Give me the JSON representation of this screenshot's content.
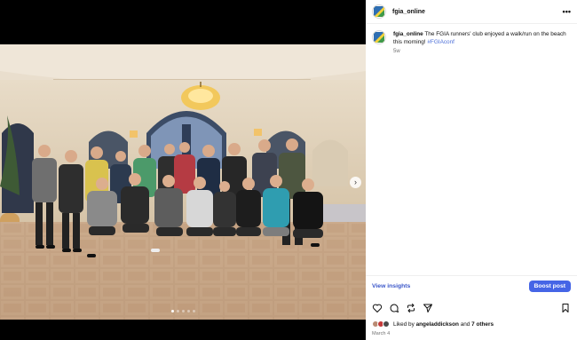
{
  "post": {
    "username": "fgia_online",
    "caption_text": "The FGIA runners' club enjoyed a walk/run on the beach this morning!",
    "hashtag": "#FGIAconf",
    "time_ago": "5w",
    "date": "March 4"
  },
  "insights": {
    "view_label": "View insights",
    "boost_label": "Boost post"
  },
  "likes": {
    "prefix": "Liked by",
    "first_user": "angeladdickson",
    "joiner": "and",
    "others": "7 others"
  },
  "carousel": {
    "slide_count": 5,
    "active_slide": 1
  },
  "icons": {
    "header_more": "more-horizontal-icon",
    "like": "heart-icon",
    "comment": "comment-icon",
    "repost": "repost-icon",
    "share": "send-icon",
    "save": "bookmark-icon",
    "next": "chevron-right-icon"
  },
  "colors": {
    "accent_link": "#3a56c9",
    "boost_button": "#4565e6",
    "hashtag": "#4d6fd8"
  }
}
